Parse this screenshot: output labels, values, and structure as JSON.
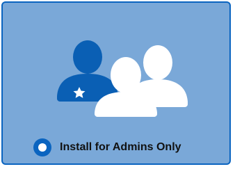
{
  "install_option": {
    "label": "Install for Admins Only",
    "selected": true,
    "icon": "admin-users-icon"
  },
  "colors": {
    "card_background": "#7aa8d8",
    "card_border": "#0a64c0",
    "admin_figure": "#0a5fb4",
    "user_figures": "#ffffff",
    "radio_fill": "#0a64c0"
  }
}
